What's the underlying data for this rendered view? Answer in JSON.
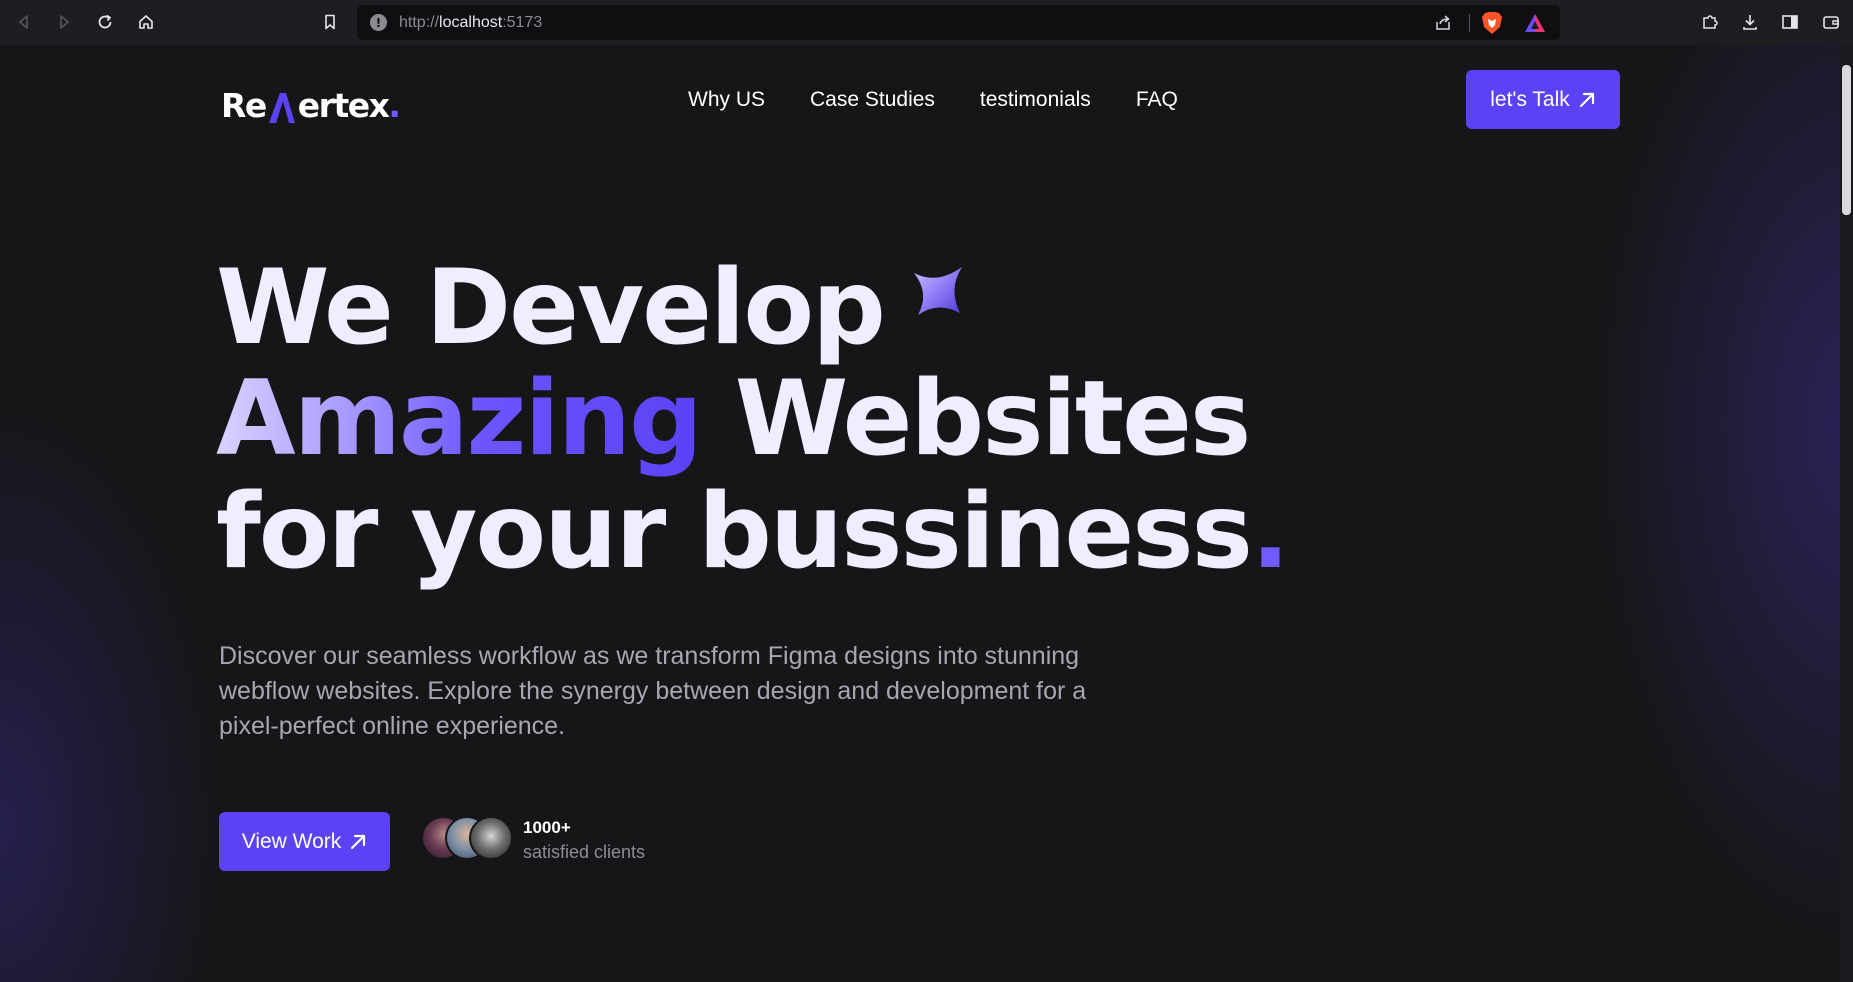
{
  "browser": {
    "url_scheme": "http://",
    "url_host": "localhost",
    "url_port": ":5173",
    "icons": [
      "back-icon",
      "forward-icon",
      "reload-icon",
      "home-icon",
      "bookmark-icon",
      "site-info-icon",
      "share-icon",
      "brave-shields-icon",
      "brave-rewards-icon",
      "extensions-icon",
      "downloads-icon",
      "sidebar-icon",
      "wallet-icon"
    ]
  },
  "header": {
    "logo_left": "Re",
    "logo_right": "ertex",
    "logo_dot": ".",
    "nav": [
      "Why US",
      "Case Studies",
      "testimonials",
      "FAQ"
    ],
    "cta_label": "let's Talk"
  },
  "hero": {
    "line1": "We Develop",
    "line2_highlight": "Amazing",
    "line2_rest": " Websites",
    "line3": "for your bussiness",
    "line3_dot": ".",
    "description": "Discover our seamless workflow as we transform Figma designs into stunning webflow websites. Explore the synergy between design and development for a pixel-perfect online experience.",
    "view_work_label": "View Work",
    "clients_count": "1000+",
    "clients_label": "satisfied clients"
  },
  "colors": {
    "accent": "#5b43f5",
    "background": "#161618",
    "heading": "#efedff",
    "muted_text": "#a7a7b3"
  }
}
